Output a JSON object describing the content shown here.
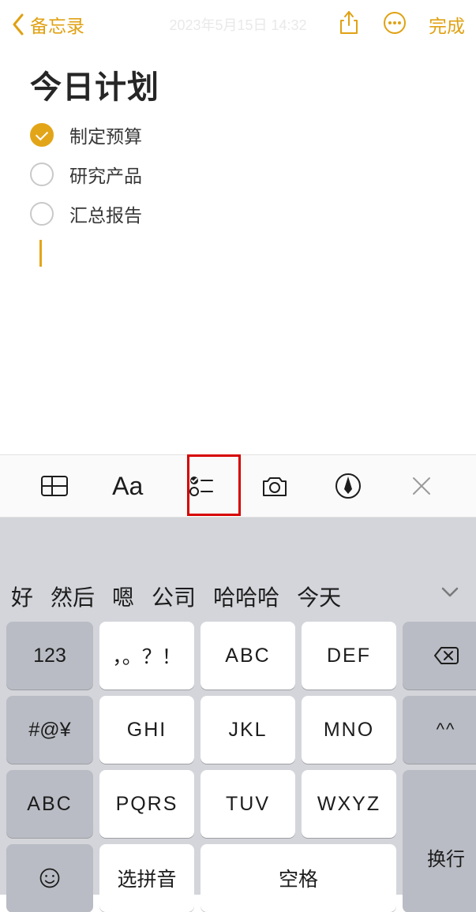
{
  "nav": {
    "back_label": "备忘录",
    "timestamp": "2023年5月15日 14:32",
    "done_label": "完成"
  },
  "note": {
    "title": "今日计划",
    "items": [
      {
        "label": "制定预算",
        "done": true
      },
      {
        "label": "研究产品",
        "done": false
      },
      {
        "label": "汇总报告",
        "done": false
      }
    ]
  },
  "fmt": {
    "aa_label": "Aa"
  },
  "candidates": [
    "好",
    "然后",
    "嗯",
    "公司",
    "哈哈哈",
    "今天"
  ],
  "keys": {
    "r1": [
      "123",
      "，。？！",
      "ABC",
      "DEF"
    ],
    "r2": [
      "#@¥",
      "GHI",
      "JKL",
      "MNO"
    ],
    "r3": [
      "ABC",
      "PQRS",
      "TUV",
      "WXYZ"
    ],
    "r4_pinyin": "选拼音",
    "r4_space": "空格",
    "face_key": "^^",
    "enter": "换行"
  }
}
